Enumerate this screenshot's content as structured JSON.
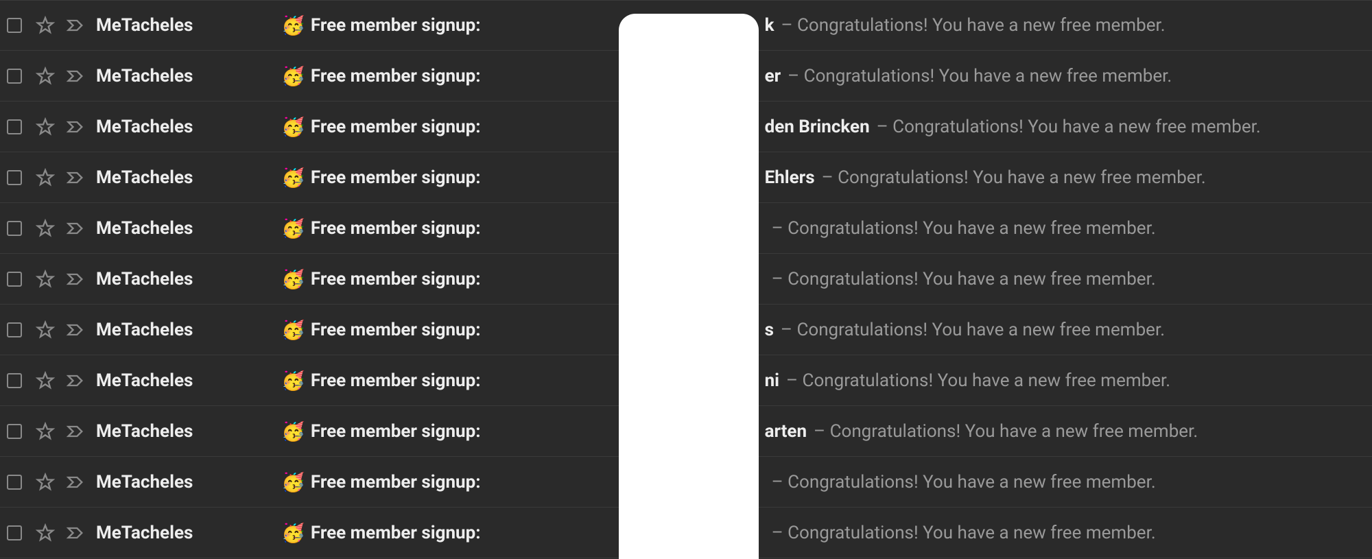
{
  "subject_prefix": "Free member signup:",
  "preview_separator": " – ",
  "preview_text": "Congratulations! You have a new free member.",
  "emails": [
    {
      "sender": "MeTacheles",
      "name_fragment": "k"
    },
    {
      "sender": "MeTacheles",
      "name_fragment": "er"
    },
    {
      "sender": "MeTacheles",
      "name_fragment": "den Brincken"
    },
    {
      "sender": "MeTacheles",
      "name_fragment": "Ehlers"
    },
    {
      "sender": "MeTacheles",
      "name_fragment": ""
    },
    {
      "sender": "MeTacheles",
      "name_fragment": ""
    },
    {
      "sender": "MeTacheles",
      "name_fragment": "s"
    },
    {
      "sender": "MeTacheles",
      "name_fragment": "ni"
    },
    {
      "sender": "MeTacheles",
      "name_fragment": "arten"
    },
    {
      "sender": "MeTacheles",
      "name_fragment": ""
    },
    {
      "sender": "MeTacheles",
      "name_fragment": ""
    }
  ]
}
